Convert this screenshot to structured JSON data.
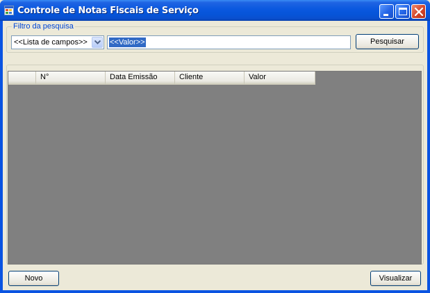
{
  "window": {
    "title": "Controle de Notas Fiscais de Serviço"
  },
  "filter": {
    "group_label": "Filtro da pesquisa",
    "field_combo_value": "<<Lista de campos>>",
    "value_input": "<<Valor>>",
    "search_button": "Pesquisar"
  },
  "grid": {
    "columns": [
      "",
      "N°",
      "Data Emissão",
      "Cliente",
      "Valor"
    ],
    "rows": []
  },
  "actions": {
    "new_button": "Novo",
    "view_button": "Visualizar"
  },
  "icons": {
    "app": "app-window-icon",
    "minimize": "minimize-icon",
    "maximize": "maximize-icon",
    "close": "close-icon",
    "combo": "chevron-down-icon"
  },
  "colors": {
    "titlebar": "#0a58df",
    "client": "#ece9d8",
    "grid_background": "#808080",
    "group_label": "#0046d5",
    "selection": "#316ac5"
  }
}
